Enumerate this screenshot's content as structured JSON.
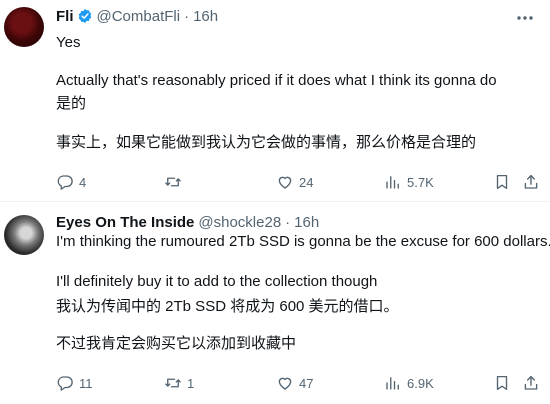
{
  "tweets": [
    {
      "display_name": "Fli",
      "handle": "@CombatFli",
      "separator": "·",
      "time": "16h",
      "lines": [
        "Yes",
        "Actually that's reasonably priced if it does what I think its gonna do",
        "是的",
        "事实上，如果它能做到我认为它会做的事情，那么价格是合理的"
      ],
      "replies": "4",
      "retweets": "",
      "likes": "24",
      "views": "5.7K"
    },
    {
      "display_name": "Eyes On The Inside",
      "handle": "@shockle28",
      "separator": "·",
      "time": "16h",
      "lines": [
        "I'm thinking the rumoured 2Tb SSD is gonna be the excuse for 600 dollars.",
        "I'll definitely buy it to add to the collection though",
        "我认为传闻中的 2Tb SSD 将成为 600 美元的借口。",
        "不过我肯定会购买它以添加到收藏中"
      ],
      "replies": "11",
      "retweets": "1",
      "likes": "47",
      "views": "6.9K"
    }
  ],
  "colors": {
    "text": "#0f1419",
    "secondary": "#536471",
    "verified": "#1d9bf0",
    "divider": "#eff3f4"
  },
  "icons": [
    "verified-badge-icon",
    "more-options-icon",
    "reply-icon",
    "retweet-icon",
    "like-icon",
    "views-icon",
    "bookmark-icon",
    "share-icon"
  ]
}
